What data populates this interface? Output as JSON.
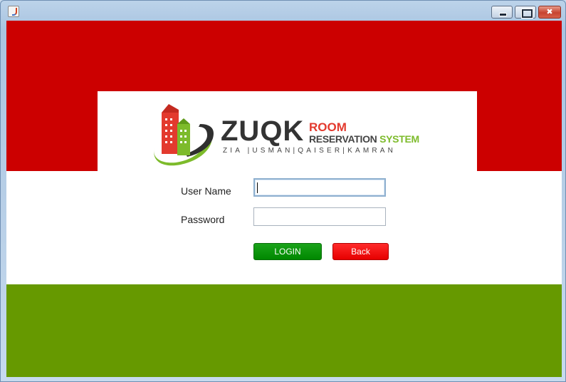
{
  "window": {
    "icon": "java-cup-icon",
    "controls": [
      "minimize-icon",
      "maximize-icon",
      "close-icon"
    ]
  },
  "colors": {
    "top_band": "#cc0000",
    "bottom_band": "#669900",
    "login_button": "#009900",
    "back_button": "#ff0000"
  },
  "logo": {
    "brand": "ZUQK",
    "line1": "ROOM",
    "line2a": "RESERVATION",
    "line2b": "SYSTEM",
    "authors": "ZIA |USMAN|QAISER|KAMRAN"
  },
  "form": {
    "username_label": "User Name",
    "username_value": "",
    "password_label": "Password",
    "password_value": "",
    "login_label": "LOGIN",
    "back_label": "Back"
  }
}
